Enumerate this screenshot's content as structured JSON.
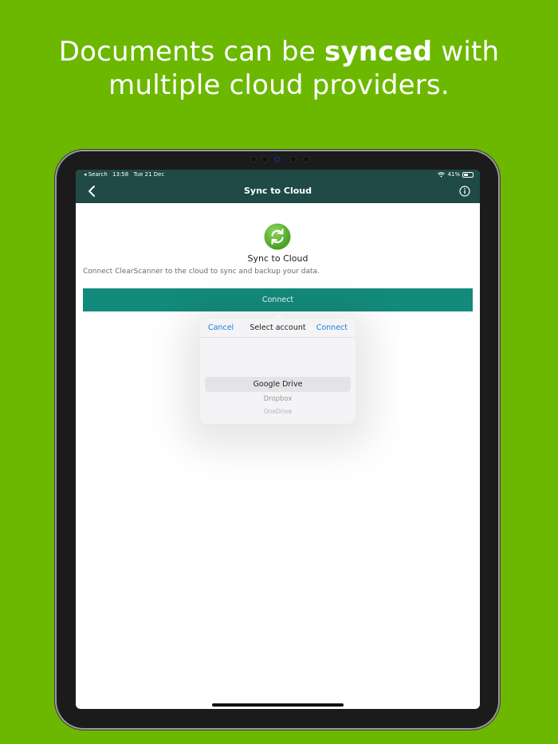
{
  "headline": {
    "part1": "Documents can be ",
    "bold": "synced",
    "part2": " with",
    "line2": "multiple cloud providers."
  },
  "statusbar": {
    "back_app": "◂ Search",
    "time": "13:58",
    "date": "Tue 21 Dec",
    "battery": "41%"
  },
  "navbar": {
    "title": "Sync to Cloud",
    "back_icon": "chevron-left-icon",
    "info_icon": "info-icon"
  },
  "content": {
    "heading": "Sync to Cloud",
    "description": "Connect ClearScanner to the cloud to sync and backup your data.",
    "connect_button": "Connect"
  },
  "picker": {
    "cancel": "Cancel",
    "title": "Select account",
    "connect": "Connect",
    "options": [
      "Google Drive",
      "Dropbox",
      "OneDrive"
    ]
  },
  "colors": {
    "background": "#6cb800",
    "nav": "#1f4a45",
    "accent": "#138a7c",
    "link": "#1a7fd4"
  }
}
